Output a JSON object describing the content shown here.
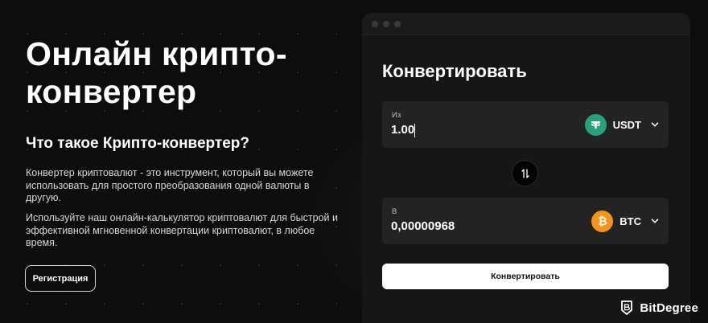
{
  "hero": {
    "title_line1": "Онлайн крипто-",
    "title_line2": "конвертер",
    "subtitle": "Что такое Крипто-конвертер?",
    "paragraph1": "Конвертер криптовалют - это инструмент, который вы можете использовать для простого преобразования одной валюты в другую.",
    "paragraph2": "Используйте наш онлайн-калькулятор криптовалют для быстрой и эффективной мгновенной конвертации криптовалют, в любое время.",
    "register_label": "Регистрация"
  },
  "converter": {
    "title": "Конвертировать",
    "from": {
      "label": "Из",
      "value": "1.00",
      "currency": "USDT",
      "coin_color": "#26a17b",
      "coin_icon": "tether-icon"
    },
    "to": {
      "label": "В",
      "value": "0,00000968",
      "currency": "BTC",
      "coin_color": "#f7931a",
      "coin_icon": "bitcoin-icon"
    },
    "swap_icon": "swap-arrows-icon",
    "convert_label": "Конвертировать"
  },
  "watermark": {
    "brand": "BitDegree"
  },
  "colors": {
    "background": "#0d0d0d",
    "card": "#161616",
    "field": "#232323",
    "usdt": "#26a17b",
    "btc": "#f7931a"
  }
}
